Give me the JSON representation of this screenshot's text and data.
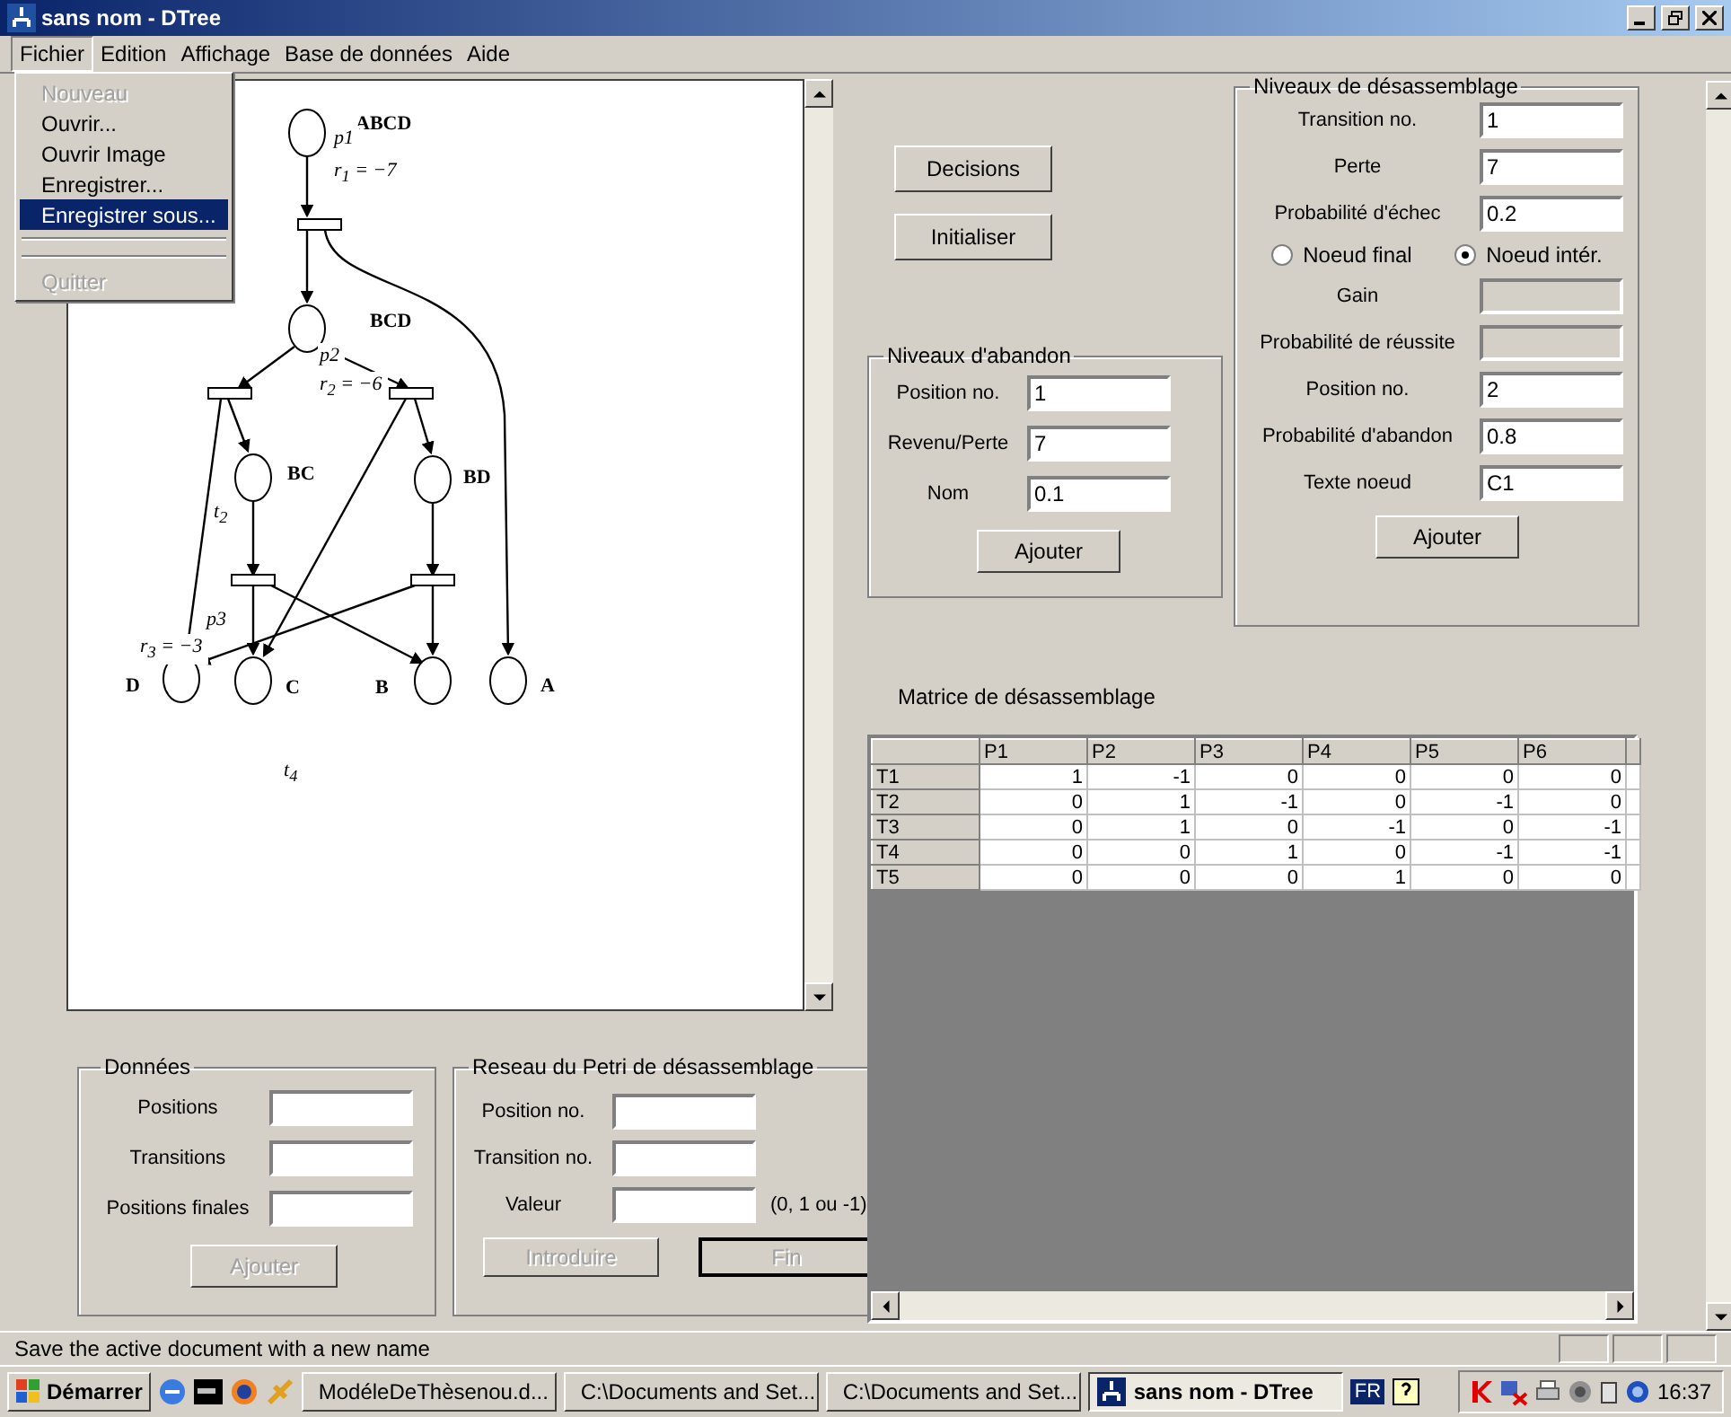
{
  "window": {
    "title": "sans nom - DTree"
  },
  "menu_bar": [
    {
      "label": "Fichier",
      "selected": true
    },
    {
      "label": "Edition",
      "selected": false
    },
    {
      "label": "Affichage",
      "selected": false
    },
    {
      "label": "Base de données",
      "selected": false
    },
    {
      "label": "Aide",
      "selected": false
    }
  ],
  "file_menu": [
    {
      "kind": "item",
      "label": "Nouveau",
      "disabled": true,
      "selected": false
    },
    {
      "kind": "item",
      "label": "Ouvrir...",
      "disabled": false,
      "selected": false
    },
    {
      "kind": "item",
      "label": "Ouvrir Image",
      "disabled": false,
      "selected": false
    },
    {
      "kind": "item",
      "label": "Enregistrer...",
      "disabled": false,
      "selected": false
    },
    {
      "kind": "item",
      "label": "Enregistrer sous...",
      "disabled": false,
      "selected": true
    },
    {
      "kind": "separator"
    },
    {
      "kind": "separator"
    },
    {
      "kind": "item",
      "label": "Quitter",
      "disabled": true,
      "selected": false
    }
  ],
  "diagram": {
    "labels": [
      "ABCD",
      "p1",
      "r$_{1}$ = −7",
      "BCD",
      "p2",
      "r$_{2}$ = −6",
      "BC",
      "BD",
      "t$_{2}$",
      "p3",
      "r$_{3}$ = −3",
      "D",
      "C",
      "B",
      "A",
      "t$_{4}$"
    ]
  },
  "donnees": {
    "title": "Données",
    "fields": [
      {
        "label": "Positions"
      },
      {
        "label": "Transitions"
      },
      {
        "label": "Positions finales"
      }
    ],
    "button": {
      "label": "Ajouter",
      "disabled": true
    }
  },
  "reseau": {
    "title": "Reseau du Petri de désassemblage",
    "fields": [
      {
        "label": "Position no."
      },
      {
        "label": "Transition no."
      },
      {
        "label": "Valeur",
        "hint": "(0, 1 ou -1)"
      }
    ],
    "buttons": [
      {
        "label": "Introduire",
        "disabled": true,
        "default": false
      },
      {
        "label": "Fin",
        "disabled": true,
        "default": true
      }
    ]
  },
  "actions": [
    {
      "label": "Decisions"
    },
    {
      "label": "Initialiser"
    }
  ],
  "abandon": {
    "title": "Niveaux d'abandon",
    "fields": [
      {
        "label": "Position no.",
        "value": "1"
      },
      {
        "label": "Revenu/Perte",
        "value": "7"
      },
      {
        "label": "Nom",
        "value": "0.1"
      }
    ],
    "button": {
      "label": "Ajouter"
    }
  },
  "desassemblage": {
    "title": "Niveaux de désassemblage",
    "rows": [
      {
        "kind": "field",
        "label": "Transition no.",
        "value": "1",
        "disabled": false
      },
      {
        "kind": "field",
        "label": "Perte",
        "value": "7",
        "disabled": false
      },
      {
        "kind": "field",
        "label": "Probabilité d'échec",
        "value": "0.2",
        "disabled": false
      },
      {
        "kind": "radios",
        "options": [
          {
            "label": "Noeud final",
            "selected": false
          },
          {
            "label": "Noeud intér.",
            "selected": true
          }
        ]
      },
      {
        "kind": "field",
        "label": "Gain",
        "disabled": true
      },
      {
        "kind": "field",
        "label": "Probabilité de réussite",
        "disabled": true
      },
      {
        "kind": "field",
        "label": "Position no.",
        "value": "2",
        "disabled": false
      },
      {
        "kind": "field",
        "label": "Probabilité d'abandon",
        "value": "0.8",
        "disabled": false
      },
      {
        "kind": "field",
        "label": "Texte noeud",
        "value": "C1",
        "disabled": false
      }
    ],
    "button": {
      "label": "Ajouter"
    }
  },
  "matrix": {
    "title": "Matrice de désassemblage",
    "columns": [
      "P1",
      "P2",
      "P3",
      "P4",
      "P5",
      "P6"
    ],
    "rows": [
      {
        "label": "T1",
        "values": [
          "1",
          "-1",
          "0",
          "0",
          "0",
          "0"
        ]
      },
      {
        "label": "T2",
        "values": [
          "0",
          "1",
          "-1",
          "0",
          "-1",
          "0"
        ]
      },
      {
        "label": "T3",
        "values": [
          "0",
          "1",
          "0",
          "-1",
          "0",
          "-1"
        ]
      },
      {
        "label": "T4",
        "values": [
          "0",
          "0",
          "1",
          "0",
          "-1",
          "-1"
        ]
      },
      {
        "label": "T5",
        "values": [
          "0",
          "0",
          "0",
          "1",
          "0",
          "0"
        ]
      }
    ]
  },
  "status_bar": {
    "text": "Save the active document with a new name"
  },
  "taskbar": {
    "start": "Démarrer",
    "tasks": [
      {
        "label": "ModéleDeThèsenou.d...",
        "kind": "document",
        "selected": false
      },
      {
        "label": "C:\\Documents and Set...",
        "kind": "folder",
        "selected": false
      },
      {
        "label": "C:\\Documents and Set...",
        "kind": "folder",
        "selected": false
      },
      {
        "label": "sans nom - DTree",
        "kind": "app",
        "selected": true
      }
    ],
    "language": "FR",
    "clock": "16:37"
  }
}
